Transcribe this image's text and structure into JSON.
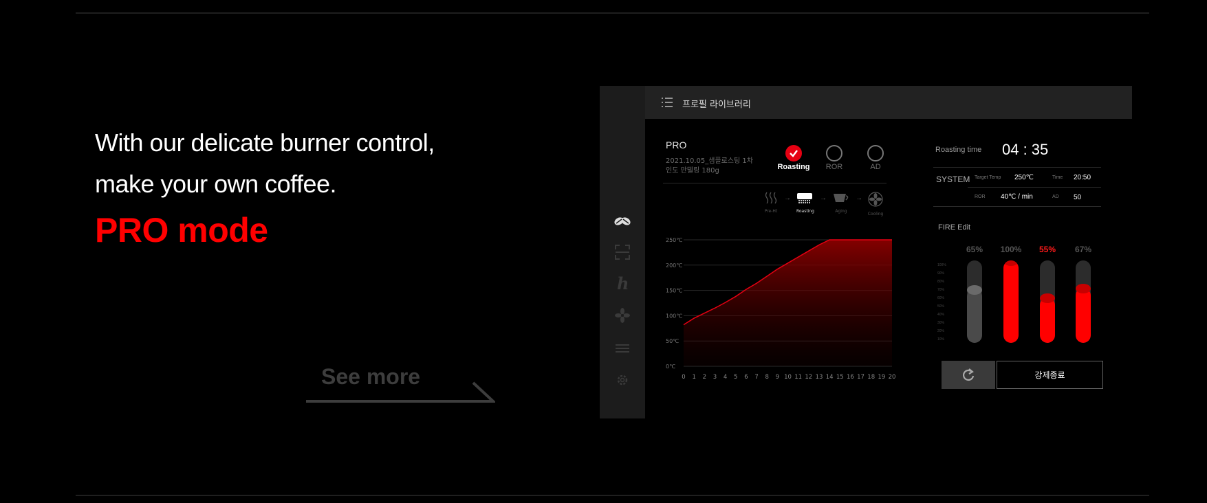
{
  "copy": {
    "line1": "With our delicate burner control,",
    "line2": "make your own coffee.",
    "mode": "PRO mode",
    "see_more": "See more"
  },
  "device": {
    "topbar": {
      "title": "프로필 라이브러리",
      "menu_icon": "list-icon"
    },
    "sidebar": {
      "icons": [
        "coffee-beans-icon",
        "scan-icon",
        "h-logo-icon",
        "fan-icon",
        "menu-lines-icon",
        "gear-icon"
      ]
    },
    "profile": {
      "name": "PRO",
      "date_line": "2021.10.05_샘플로스팅 1차",
      "bean_line": "인도 만델링 180g"
    },
    "mode_tabs": [
      {
        "label": "Roasting",
        "active": true
      },
      {
        "label": "ROR",
        "active": false
      },
      {
        "label": "AD",
        "active": false
      }
    ],
    "stages": [
      {
        "label": "Pre-Ht",
        "icon": "heat-waves-icon",
        "active": false
      },
      {
        "label": "Roasting",
        "icon": "roaster-icon",
        "active": true
      },
      {
        "label": "Aging",
        "icon": "cup-icon",
        "active": false
      },
      {
        "label": "Cooling",
        "icon": "fan-icon",
        "active": false
      }
    ],
    "roasting_time": {
      "label": "Roasting time",
      "value": "04 : 35"
    },
    "system": {
      "title": "SYSTEM",
      "target_temp_label": "Target Temp",
      "target_temp": "250℃",
      "time_label": "Time",
      "time": "20:50",
      "ror_label": "ROR",
      "ror": "40℃ / min",
      "ad_label": "AD",
      "ad": "50"
    },
    "fire": {
      "title": "FIRE Edit",
      "scale": [
        "100%",
        "90%",
        "80%",
        "70%",
        "60%",
        "50%",
        "40%",
        "30%",
        "20%",
        "10%"
      ],
      "burners": [
        {
          "label": "65%",
          "level": 0.65,
          "active": false,
          "highlight": false
        },
        {
          "label": "100%",
          "level": 1.0,
          "active": true,
          "highlight": false
        },
        {
          "label": "55%",
          "level": 0.55,
          "active": true,
          "highlight": true
        },
        {
          "label": "67%",
          "level": 0.67,
          "active": true,
          "highlight": false
        }
      ]
    },
    "buttons": {
      "reset_icon": "refresh-icon",
      "stop_label": "강제종료"
    },
    "colors": {
      "accent": "#ff0000",
      "panel": "#1c1c1c",
      "topbar": "#222222"
    }
  },
  "chart_data": {
    "type": "area",
    "x": [
      0,
      1,
      2,
      3,
      4,
      5,
      6,
      7,
      8,
      9,
      10,
      11,
      12,
      13,
      14,
      15,
      16,
      17,
      18,
      19,
      20
    ],
    "values": [
      82,
      95,
      105,
      115,
      126,
      138,
      152,
      164,
      178,
      192,
      204,
      216,
      228,
      240,
      252,
      262,
      262,
      262,
      262,
      262,
      262
    ],
    "y_ticks": [
      "250℃",
      "200℃",
      "150℃",
      "100℃",
      "50℃",
      "0℃"
    ],
    "ylim": [
      0,
      250
    ],
    "xlim": [
      0,
      20
    ],
    "grid": true,
    "color": "#e60012"
  }
}
